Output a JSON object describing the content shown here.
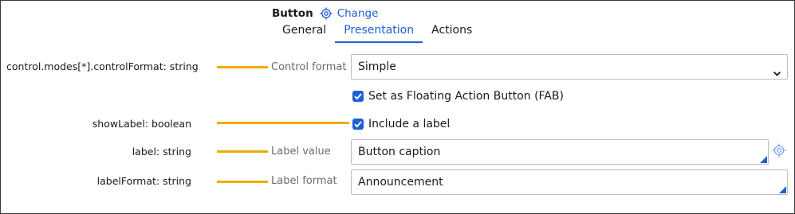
{
  "header": {
    "control_name": "Button",
    "change_label": "Change",
    "target_icon": "target-icon"
  },
  "tabs": [
    {
      "label": "General",
      "active": false
    },
    {
      "label": "Presentation",
      "active": true
    },
    {
      "label": "Actions",
      "active": false
    }
  ],
  "rows": {
    "control_format": {
      "annotation": "control.modes[*].controlFormat: string",
      "label": "Control format",
      "value": "Simple"
    },
    "fab": {
      "label": "Set as Floating Action Button (FAB)",
      "checked": true
    },
    "show_label": {
      "annotation": "showLabel: boolean",
      "label": "Include a label",
      "checked": true
    },
    "label_value": {
      "annotation": "label: string",
      "label": "Label value",
      "value": "Button caption"
    },
    "label_format": {
      "annotation": "labelFormat: string",
      "label": "Label format",
      "value": "Announcement"
    }
  },
  "colors": {
    "accent": "#1f5fd6",
    "annotation_line": "#f2a900",
    "field_label": "#6b6b6b"
  }
}
